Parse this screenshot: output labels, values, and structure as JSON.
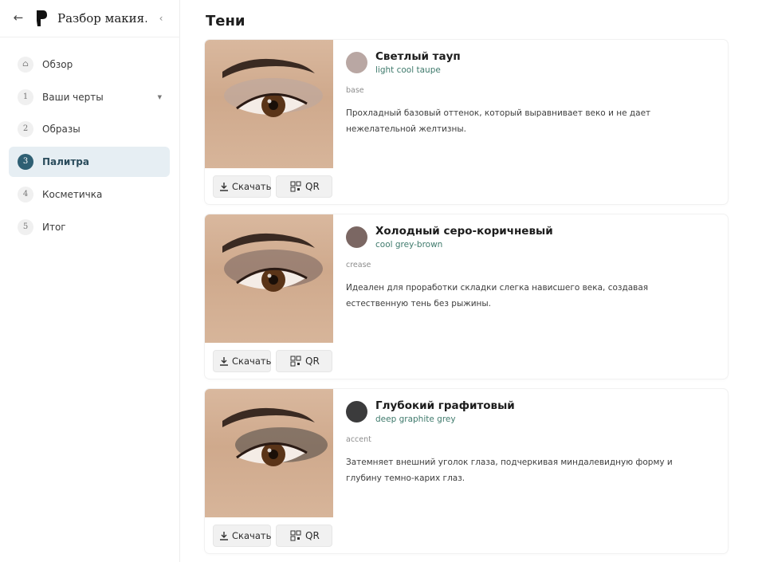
{
  "sidebar": {
    "title": "Разбор макия…",
    "back_icon": "arrow-left-icon",
    "collapse_icon": "chevron-left-icon",
    "items": [
      {
        "num": "⌂",
        "label": "Обзор",
        "active": false
      },
      {
        "num": "1",
        "label": "Ваши черты",
        "active": false,
        "has_caret": true
      },
      {
        "num": "2",
        "label": "Образы",
        "active": false
      },
      {
        "num": "3",
        "label": "Палитра",
        "active": true
      },
      {
        "num": "4",
        "label": "Косметичка",
        "active": false
      },
      {
        "num": "5",
        "label": "Итог",
        "active": false
      }
    ]
  },
  "section": {
    "title": "Тени"
  },
  "buttons": {
    "download": "Скачать",
    "qr": "QR"
  },
  "shades": [
    {
      "name": "Светлый тауп",
      "english": "light cool taupe",
      "role": "base",
      "description": "Прохладный базовый оттенок, который выравнивает веко и не дает нежелательной желтизны.",
      "color": "#b9a7a3"
    },
    {
      "name": "Холодный серо-коричневый",
      "english": "cool grey-brown",
      "role": "crease",
      "description": "Идеален для проработки складки слегка нависшего века, создавая естественную тень без рыжины.",
      "color": "#7b6763"
    },
    {
      "name": "Глубокий графитовый",
      "english": "deep graphite grey",
      "role": "accent",
      "description": "Затемняет внешний уголок глаза, подчеркивая миндалевидную форму и глубину темно-карих глаз.",
      "color": "#3b3b3c"
    }
  ]
}
